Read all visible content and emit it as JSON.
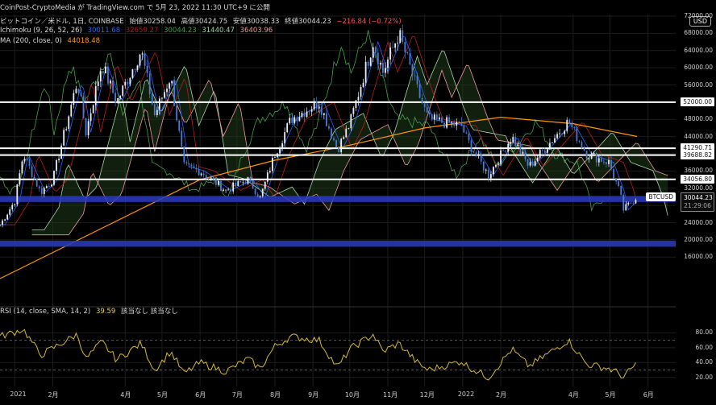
{
  "credit_text": "CoinPost-CryptoMedia が TradingView.com で 5月 23, 2022 11:30 UTC+9 に公開",
  "header": {
    "title": "ビットコイン／米ドル, 1日, COINBASE",
    "open": "始値30258.04",
    "high": "高値30424.75",
    "low": "安値30038.33",
    "close": "終値30044.23",
    "change": "−216.84 (−0.72%)"
  },
  "ichimoku": {
    "label": "Ichimoku (9, 26, 52, 26)",
    "v1": "30011.68",
    "v2": "32659.27",
    "v3": "30044.23",
    "v4": "31440.47",
    "v5": "36403.96",
    "colors": [
      "#2962ff",
      "#b71c1c",
      "#43a047",
      "#a5d6a7",
      "#ef9a9a"
    ]
  },
  "ma": {
    "label": "MA (200, close, 0)",
    "value": "44018.48",
    "color": "#ff9800"
  },
  "rsi_header": {
    "label": "RSI (14, close, SMA, 14, 2)",
    "value": "39.59",
    "extra": "該当なし  該当なし"
  },
  "currency": "USD",
  "price_tag": {
    "price": "30044.23",
    "time": "21:29:06",
    "symbol": "BTCUSD"
  },
  "levels": [
    {
      "price": "52000.00",
      "color": "white"
    },
    {
      "price": "41290.71",
      "color": "white"
    },
    {
      "price": "39688.82",
      "color": "white"
    },
    {
      "price": "34056.80",
      "color": "white"
    }
  ],
  "zones": [
    {
      "from": 28800,
      "to": 30200,
      "color": "#2b3bbd"
    },
    {
      "from": 18400,
      "to": 19800,
      "color": "#2b3bbd"
    }
  ],
  "chart_data": {
    "type": "candlestick",
    "title": "ビットコイン／米ドル, 1日, COINBASE",
    "ylim": [
      8000,
      72000
    ],
    "y_ticks": [
      72000,
      68000,
      64000,
      60000,
      56000,
      52000,
      48000,
      44000,
      40000,
      36000,
      32000,
      28000,
      24000,
      20000,
      16000
    ],
    "x_ticks": [
      "2021",
      "2月",
      "4月",
      "5月",
      "6月",
      "7月",
      "8月",
      "9月",
      "10月",
      "11月",
      "12月",
      "2022",
      "2月",
      "4月",
      "5月",
      "6月"
    ],
    "grid": true,
    "price_path": [
      [
        "2020-12-20",
        23500
      ],
      [
        "2021-01-01",
        29000
      ],
      [
        "2021-01-08",
        40000
      ],
      [
        "2021-01-22",
        31000
      ],
      [
        "2021-02-01",
        34000
      ],
      [
        "2021-02-21",
        57000
      ],
      [
        "2021-02-28",
        45000
      ],
      [
        "2021-03-13",
        61000
      ],
      [
        "2021-03-25",
        52000
      ],
      [
        "2021-04-14",
        64000
      ],
      [
        "2021-04-25",
        49000
      ],
      [
        "2021-05-08",
        58000
      ],
      [
        "2021-05-19",
        37000
      ],
      [
        "2021-06-01",
        36000
      ],
      [
        "2021-06-22",
        31500
      ],
      [
        "2021-07-10",
        34000
      ],
      [
        "2021-07-20",
        29800
      ],
      [
        "2021-08-01",
        40000
      ],
      [
        "2021-08-14",
        48000
      ],
      [
        "2021-09-06",
        52000
      ],
      [
        "2021-09-21",
        41000
      ],
      [
        "2021-10-01",
        47000
      ],
      [
        "2021-10-20",
        66000
      ],
      [
        "2021-10-28",
        59000
      ],
      [
        "2021-11-10",
        68000
      ],
      [
        "2021-11-26",
        54000
      ],
      [
        "2021-12-04",
        48000
      ],
      [
        "2021-12-31",
        46500
      ],
      [
        "2022-01-05",
        43000
      ],
      [
        "2022-01-22",
        35000
      ],
      [
        "2022-02-10",
        44000
      ],
      [
        "2022-02-24",
        37000
      ],
      [
        "2022-03-28",
        47500
      ],
      [
        "2022-04-12",
        40000
      ],
      [
        "2022-04-30",
        38000
      ],
      [
        "2022-05-09",
        31000
      ],
      [
        "2022-05-12",
        27000
      ],
      [
        "2022-05-23",
        30044
      ]
    ],
    "ma200_path": [
      [
        "2020-12-20",
        11000
      ],
      [
        "2021-03-01",
        21000
      ],
      [
        "2021-06-01",
        34000
      ],
      [
        "2021-08-01",
        38500
      ],
      [
        "2021-10-01",
        42000
      ],
      [
        "2021-12-01",
        46000
      ],
      [
        "2022-02-01",
        48500
      ],
      [
        "2022-04-01",
        47000
      ],
      [
        "2022-05-23",
        44018
      ]
    ],
    "rsi_ylim": [
      10,
      100
    ],
    "rsi_ticks": [
      80,
      60,
      40,
      20
    ],
    "rsi_levels": [
      70,
      30
    ],
    "rsi_path": [
      [
        "2020-12-20",
        75
      ],
      [
        "2021-01-08",
        85
      ],
      [
        "2021-01-22",
        50
      ],
      [
        "2021-02-21",
        78
      ],
      [
        "2021-02-28",
        45
      ],
      [
        "2021-03-13",
        68
      ],
      [
        "2021-03-25",
        44
      ],
      [
        "2021-04-14",
        66
      ],
      [
        "2021-04-25",
        30
      ],
      [
        "2021-05-08",
        55
      ],
      [
        "2021-05-19",
        25
      ],
      [
        "2021-06-01",
        40
      ],
      [
        "2021-06-22",
        28
      ],
      [
        "2021-07-10",
        45
      ],
      [
        "2021-07-20",
        32
      ],
      [
        "2021-08-01",
        62
      ],
      [
        "2021-08-14",
        75
      ],
      [
        "2021-09-06",
        70
      ],
      [
        "2021-09-21",
        33
      ],
      [
        "2021-10-01",
        58
      ],
      [
        "2021-10-20",
        78
      ],
      [
        "2021-10-28",
        55
      ],
      [
        "2021-11-10",
        66
      ],
      [
        "2021-11-26",
        38
      ],
      [
        "2021-12-04",
        30
      ],
      [
        "2021-12-31",
        42
      ],
      [
        "2022-01-05",
        35
      ],
      [
        "2022-01-22",
        20
      ],
      [
        "2022-02-10",
        58
      ],
      [
        "2022-02-24",
        35
      ],
      [
        "2022-03-28",
        70
      ],
      [
        "2022-04-12",
        38
      ],
      [
        "2022-04-30",
        32
      ],
      [
        "2022-05-09",
        25
      ],
      [
        "2022-05-12",
        20
      ],
      [
        "2022-05-23",
        39.59
      ]
    ]
  }
}
